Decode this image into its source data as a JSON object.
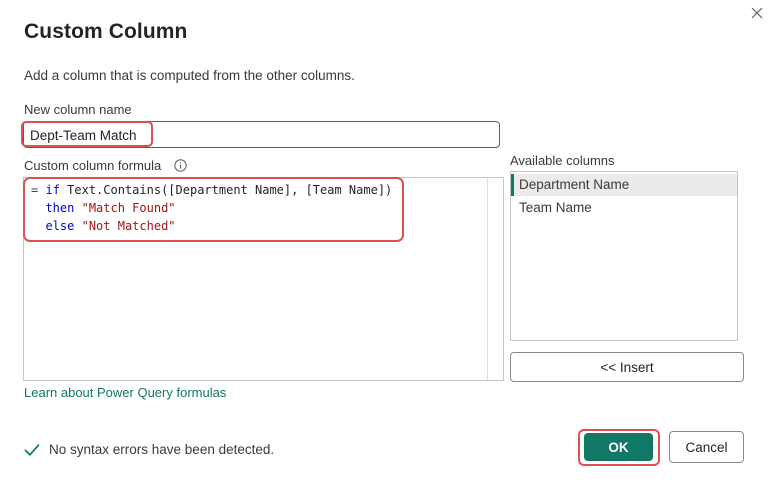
{
  "dialog": {
    "title": "Custom Column",
    "description": "Add a column that is computed from the other columns."
  },
  "name_field": {
    "label": "New column name",
    "value": "Dept-Team Match"
  },
  "formula": {
    "label": "Custom column formula",
    "lines": [
      {
        "eq": "=",
        "kw": "if",
        "text": "Text.Contains([Department Name], [Team Name])"
      },
      {
        "kw": "then",
        "str": "\"Match Found\""
      },
      {
        "kw": "else",
        "str": "\"Not Matched\""
      }
    ]
  },
  "available_columns": {
    "label": "Available columns",
    "items": [
      "Department Name",
      "Team Name"
    ],
    "selected": "Department Name"
  },
  "buttons": {
    "insert": "<< Insert",
    "ok": "OK",
    "cancel": "Cancel"
  },
  "learn_link": "Learn about Power Query formulas",
  "status": "No syntax errors have been detected.",
  "colors": {
    "accent": "#117865",
    "highlight": "#d9534f",
    "keyword": "#0000cc",
    "string": "#a31515"
  },
  "icons": {
    "close": "close-icon",
    "info": "info-icon",
    "check": "check-icon"
  }
}
